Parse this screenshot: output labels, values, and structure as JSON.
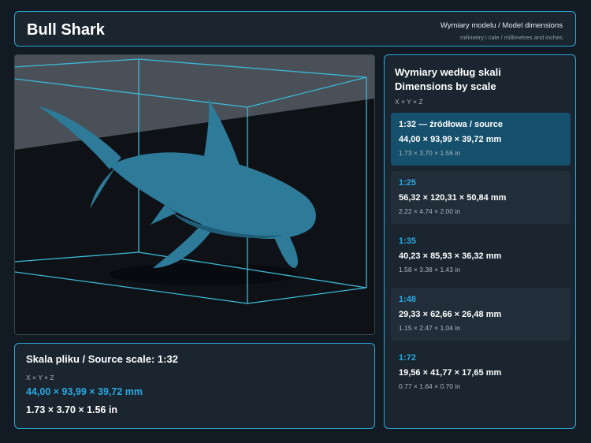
{
  "header": {
    "title": "Bull Shark",
    "subtitle": "Wymiary modelu / Model dimensions",
    "subtitle_small": "milimetry i cale / millimetres and inches"
  },
  "viewer": {
    "model_icon": "shark-model",
    "colors": {
      "model": "#2d7a99",
      "bounding_box": "#3cb8d6",
      "floor": "#101418",
      "wall": "#4a5058"
    }
  },
  "source": {
    "title": "Skala pliku / Source scale: 1:32",
    "axis": "X × Y × Z",
    "mm": "44,00 × 93,99 × 39,72 mm",
    "inches": "1.73 × 3.70 × 1.56 in"
  },
  "scales": {
    "heading_line1": "Wymiary według skali",
    "heading_line2": "Dimensions by scale",
    "axis": "X × Y × Z",
    "items": [
      {
        "label": "1:32  —  źródłowa / source",
        "mm": "44,00 × 93,99 × 39,72 mm",
        "inches": "1.73 × 3.70 × 1.56 in"
      },
      {
        "label": "1:25",
        "mm": "56,32 × 120,31 × 50,84 mm",
        "inches": "2.22 × 4.74 × 2.00 in"
      },
      {
        "label": "1:35",
        "mm": "40,23 × 85,93 × 36,32 mm",
        "inches": "1.58 × 3.38 × 1.43 in"
      },
      {
        "label": "1:48",
        "mm": "29,33 × 62,66 × 26,48 mm",
        "inches": "1.15 × 2.47 × 1.04 in"
      },
      {
        "label": "1:72",
        "mm": "19,56 × 41,77 × 17,65 mm",
        "inches": "0.77 × 1.64 × 0.70 in"
      }
    ]
  },
  "colors": {
    "accent": "#2aa8d6",
    "active_card": "#15506c",
    "background": "#121b24"
  }
}
